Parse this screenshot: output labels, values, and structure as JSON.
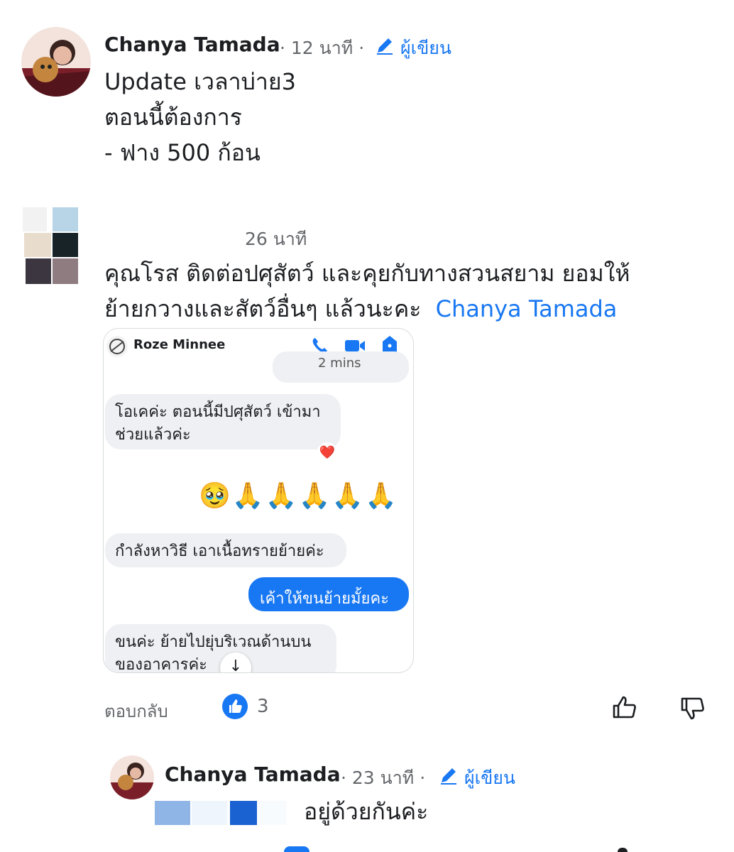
{
  "comment1": {
    "author": "Chanya Tamada",
    "time": "· 12 นาที ·",
    "author_badge": "ผู้เขียน",
    "text": "Update เวลาบ่าย3\nตอนนี้ต้องการ\n- ฟาง 500 ก้อน"
  },
  "comment2": {
    "time": "26 นาที",
    "text_line1": "คุณโรส ติดต่อปศุสัตว์ และคุยกับทางสวนสยาม ยอมให้",
    "text_line2": "ย้ายกวางและสัตว์อื่นๆ แล้วนะคะ",
    "mention": "Chanya Tamada",
    "screenshot": {
      "contact_name": "Roze Minnee",
      "top_partial": "2 mins",
      "msg1": "โอเคค่ะ ตอนนี้มีปศุสัตว์ เข้ามา\nช่วยแล้วค่ะ",
      "reaction": "❤️",
      "emoji_row": "🥹🙏🙏🙏🙏🙏",
      "msg2": "กำลังหาวิธี เอาเนื้อทรายย้ายค่ะ",
      "msg3": "เค้าให้ขนย้ายมั้ยคะ",
      "msg4": "ขนค่ะ ย้ายไปยุ่บริเวณด้านบน\nของอาคารค่ะ",
      "scroll_arrow": "↓"
    },
    "reply_label": "ตอบกลับ",
    "like_count": "3"
  },
  "comment3": {
    "author": "Chanya Tamada",
    "time": "· 23 นาที ·",
    "author_badge": "ผู้เขียน",
    "text": "อยู่ด้วยกันค่ะ"
  },
  "colors": {
    "accent": "#1877f2",
    "meta": "#65676b",
    "bubble_in": "#eef0f3"
  },
  "icons": [
    "pencil-icon",
    "phone-icon",
    "video-icon",
    "info-icon",
    "like-icon",
    "thumbs-up-outline-icon",
    "thumbs-down-outline-icon"
  ]
}
